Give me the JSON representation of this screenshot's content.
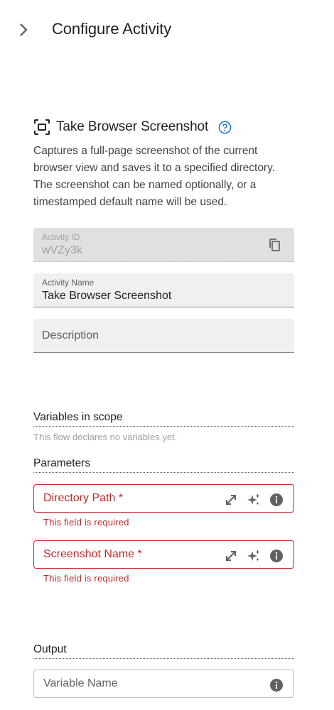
{
  "header": {
    "title": "Configure Activity",
    "collapse_icon": "chevron-right-icon"
  },
  "activity": {
    "icon": "screenshot-frame-icon",
    "title": "Take Browser Screenshot",
    "help_icon": "help-circle-icon",
    "description": "Captures a full-page screenshot of the current browser view and saves it to a specified directory. The screenshot can be named optionally, or a timestamped default name will be used."
  },
  "fields": {
    "activity_id": {
      "label": "Activity ID",
      "value": "wVZy3k",
      "copy_icon": "copy-icon"
    },
    "activity_name": {
      "label": "Activity Name",
      "value": "Take Browser Screenshot"
    },
    "description": {
      "placeholder": "Description"
    }
  },
  "variables": {
    "title": "Variables in scope",
    "empty_text": "This flow declares no variables yet."
  },
  "parameters": {
    "title": "Parameters",
    "items": [
      {
        "label": "Directory Path *",
        "error": "This field is required"
      },
      {
        "label": "Screenshot Name *",
        "error": "This field is required"
      }
    ]
  },
  "output": {
    "title": "Output",
    "variable_placeholder": "Variable Name"
  },
  "colors": {
    "error": "#c62828",
    "accent": "#1976d2",
    "icon_grey": "#616161"
  }
}
